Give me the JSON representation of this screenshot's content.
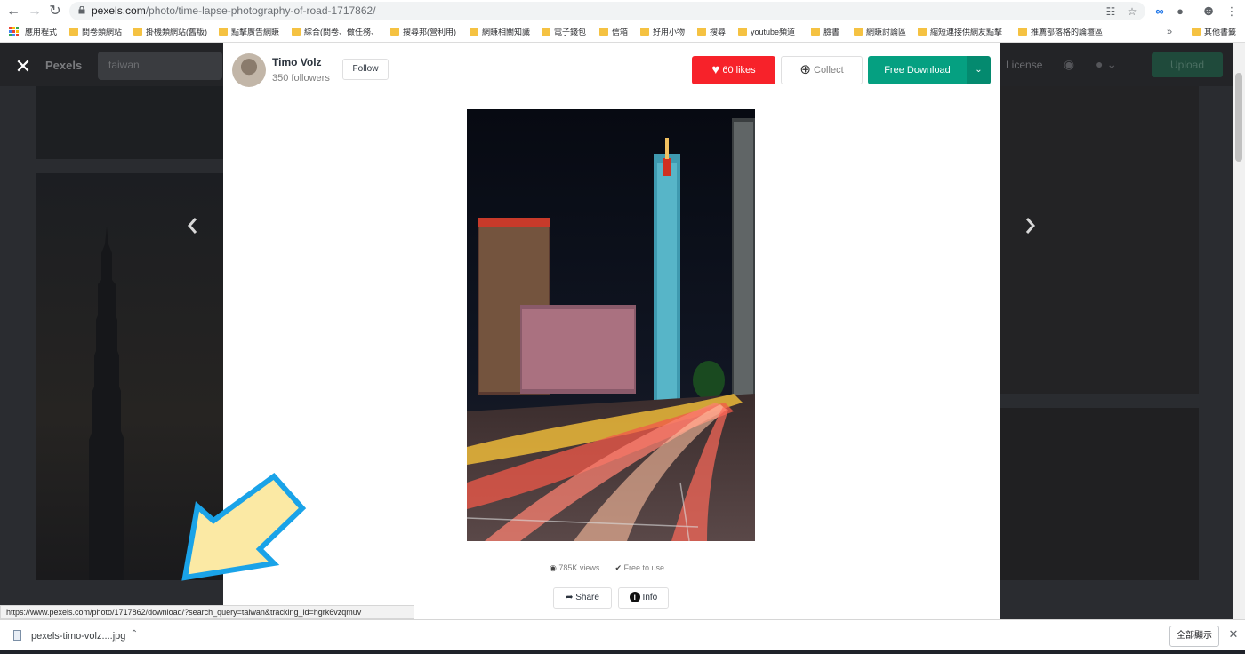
{
  "browser": {
    "url_host": "pexels.com",
    "url_path": "/photo/time-lapse-photography-of-road-1717862/",
    "bookmarks": [
      {
        "label": "應用程式"
      },
      {
        "label": "問卷類網站"
      },
      {
        "label": "掛機類網站(舊版)"
      },
      {
        "label": "點擊廣告網賺"
      },
      {
        "label": "綜合(問卷、做任務、"
      },
      {
        "label": "搜尋邦(營利用)"
      },
      {
        "label": "網賺相關知識"
      },
      {
        "label": "電子錢包"
      },
      {
        "label": "信箱"
      },
      {
        "label": "好用小物"
      },
      {
        "label": "搜尋"
      },
      {
        "label": "youtube頻道"
      },
      {
        "label": "臉書"
      },
      {
        "label": "網賺討論區"
      },
      {
        "label": "縮短連接供網友點擊"
      },
      {
        "label": "推薦部落格的論壇區"
      },
      {
        "label": "其他書籤"
      }
    ],
    "status_url": "https://www.pexels.com/photo/1717862/download/?search_query=taiwan&tracking_id=hgrk6vzqmuv"
  },
  "site": {
    "brand": "Pexels",
    "search_value": "taiwan",
    "license_link": "License",
    "upload_button": "Upload"
  },
  "modal": {
    "author_name": "Timo Volz",
    "author_followers": "350 followers",
    "follow_label": "Follow",
    "likes_label": "60 likes",
    "collect_label": "Collect",
    "download_label": "Free Download",
    "views_label": "785K views",
    "license_label": "Free to use",
    "share_label": "Share",
    "info_label": "Info"
  },
  "download_shelf": {
    "file_name": "pexels-timo-volz....jpg",
    "show_all_label": "全部顯示"
  },
  "colors": {
    "likes": "#f7222a",
    "download": "#05a081",
    "annotation_arrow_fill": "#fbe9a4",
    "annotation_arrow_stroke": "#1aa3e8"
  }
}
